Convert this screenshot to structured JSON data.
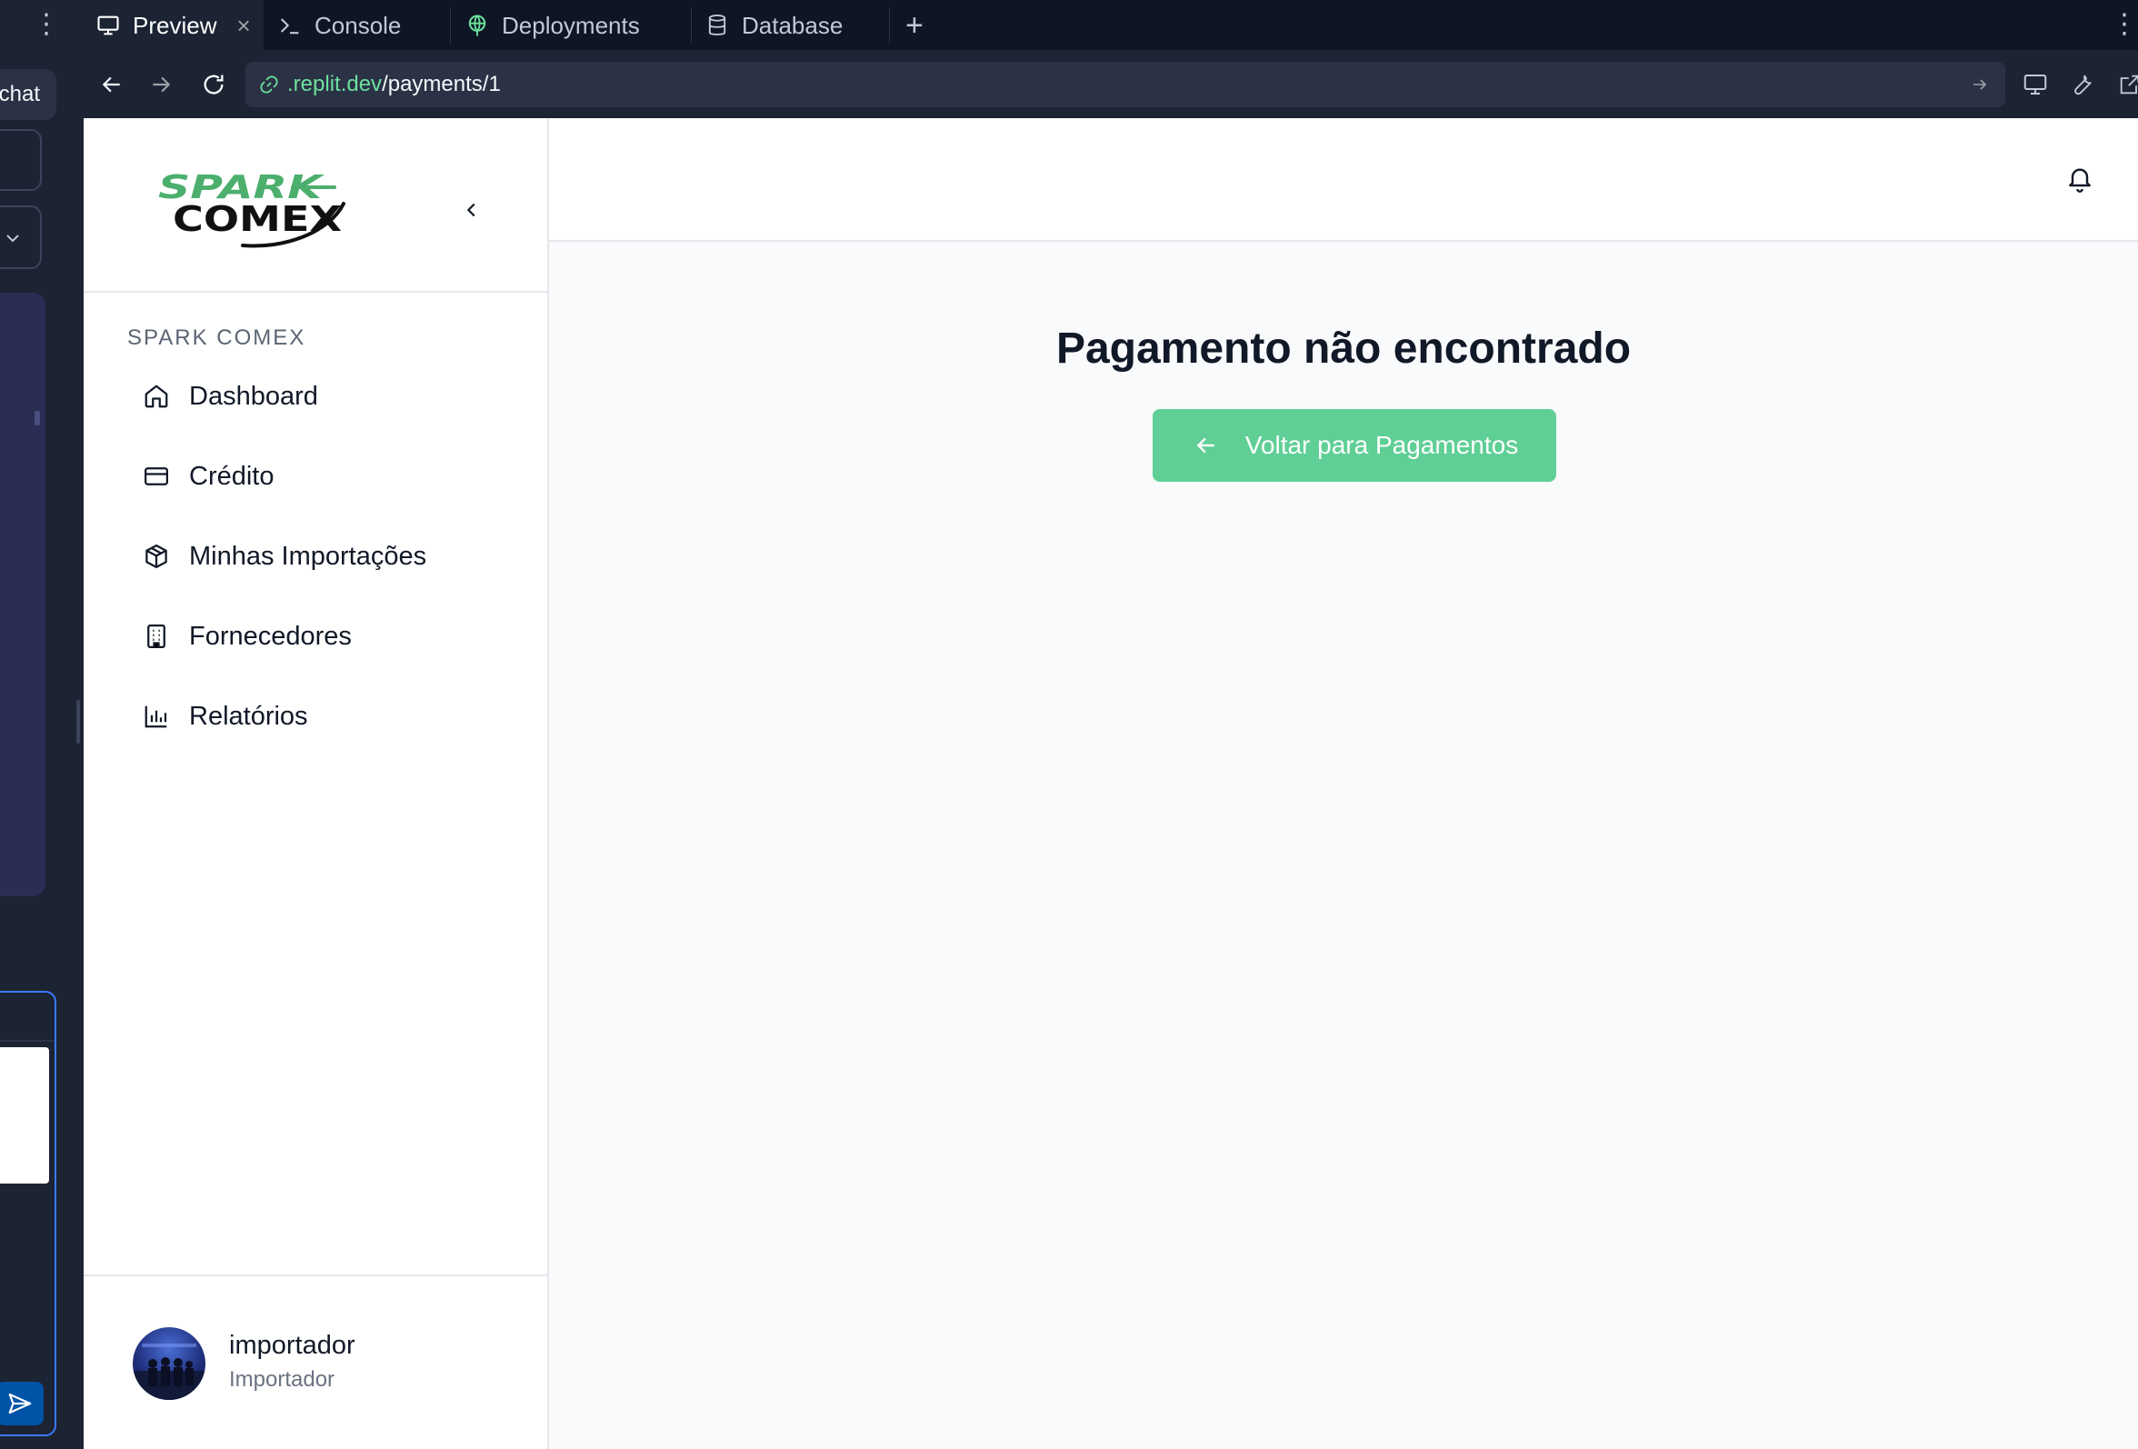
{
  "left_panel": {
    "chat_label": "chat"
  },
  "tabs": [
    {
      "label": "Preview",
      "icon": "monitor-icon",
      "active": true
    },
    {
      "label": "Console",
      "icon": "terminal-icon",
      "active": false
    },
    {
      "label": "Deployments",
      "icon": "globe-icon",
      "active": false
    },
    {
      "label": "Database",
      "icon": "database-icon",
      "active": false
    }
  ],
  "url": {
    "host": ".replit.dev",
    "path": "/payments/1"
  },
  "sidebar": {
    "logo_alt": "SPARK COMEX",
    "logo_top": "SPARK",
    "logo_bottom": "COMEX",
    "section_label": "SPARK COMEX",
    "items": [
      {
        "label": "Dashboard",
        "icon": "home-icon"
      },
      {
        "label": "Crédito",
        "icon": "credit-card-icon"
      },
      {
        "label": "Minhas Importações",
        "icon": "package-icon"
      },
      {
        "label": "Fornecedores",
        "icon": "building-icon"
      },
      {
        "label": "Relatórios",
        "icon": "bar-chart-icon"
      }
    ],
    "user": {
      "name": "importador",
      "role": "Importador"
    }
  },
  "main": {
    "title": "Pagamento não encontrado",
    "back_button": "Voltar para Pagamentos"
  },
  "colors": {
    "accent": "#5fcf95",
    "brand_green": "#4caf6e",
    "url_host": "#6ce19e"
  }
}
